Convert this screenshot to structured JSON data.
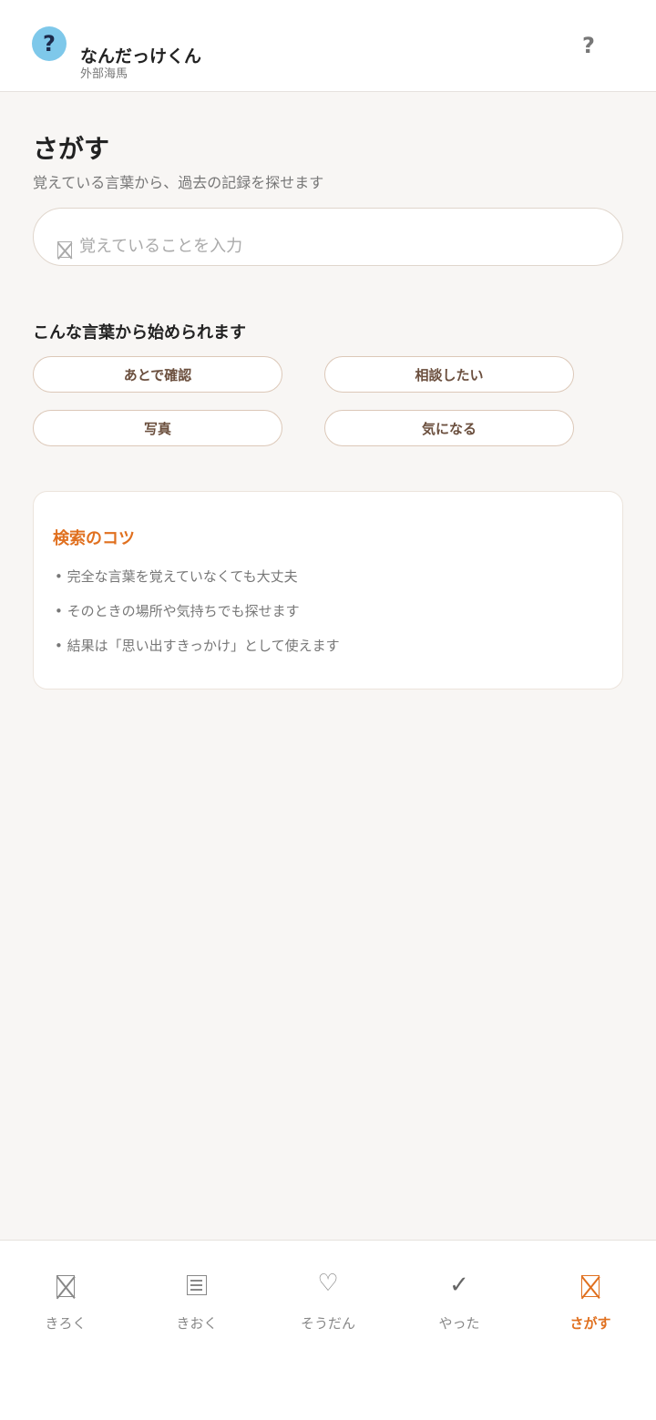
{
  "header": {
    "logo_glyph": "?",
    "app_name": "なんだっけくん",
    "app_subtitle": "外部海馬",
    "help_glyph": "?"
  },
  "page": {
    "title": "さがす",
    "description": "覚えている言葉から、過去の記録を探せます"
  },
  "search": {
    "icon": "search-box-icon",
    "placeholder": "覚えていることを入力",
    "value": ""
  },
  "suggestions": {
    "title": "こんな言葉から始められます",
    "chips": [
      "あとで確認",
      "相談したい",
      "写真",
      "気になる"
    ]
  },
  "tips": {
    "title": "検索のコツ",
    "items": [
      "• 完全な言葉を覚えていなくても大丈夫",
      "• そのときの場所や気持ちでも探せます",
      "• 結果は「思い出すきっかけ」として使えます"
    ]
  },
  "nav": {
    "items": [
      {
        "label": "きろく",
        "icon": "record-icon"
      },
      {
        "label": "きおく",
        "icon": "memory-list-icon"
      },
      {
        "label": "そうだん",
        "icon": "heart-icon",
        "glyph": "♡"
      },
      {
        "label": "やった",
        "icon": "check-icon",
        "glyph": "✓"
      },
      {
        "label": "さがす",
        "icon": "search-icon",
        "active": true
      }
    ]
  },
  "colors": {
    "accent": "#e0701f",
    "logo_bg": "#7ec8ea",
    "chip_text": "#6b4f3e",
    "background": "#f8f6f4"
  }
}
